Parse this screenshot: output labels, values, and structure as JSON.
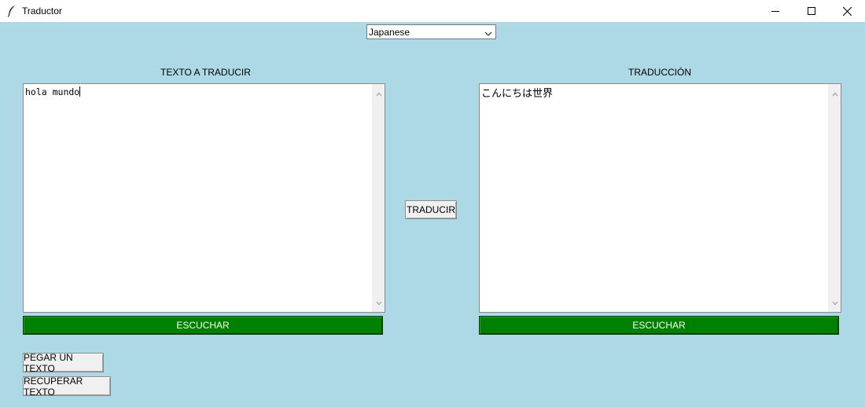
{
  "window": {
    "title": "Traductor",
    "icon": "feather-icon"
  },
  "language_select": {
    "selected": "Japanese"
  },
  "source": {
    "label": "TEXTO A TRADUCIR",
    "text": "hola mundo",
    "listen_label": "ESCUCHAR"
  },
  "target": {
    "label": "TRADUCCIÓN",
    "text": "こんにちは世界",
    "listen_label": "ESCUCHAR"
  },
  "actions": {
    "translate_label": "TRADUCIR",
    "paste_label": "PEGAR UN TEXTO",
    "recover_label": "RECUPERAR TEXTO"
  },
  "colors": {
    "background": "#add8e6",
    "listen_button": "#008000"
  }
}
